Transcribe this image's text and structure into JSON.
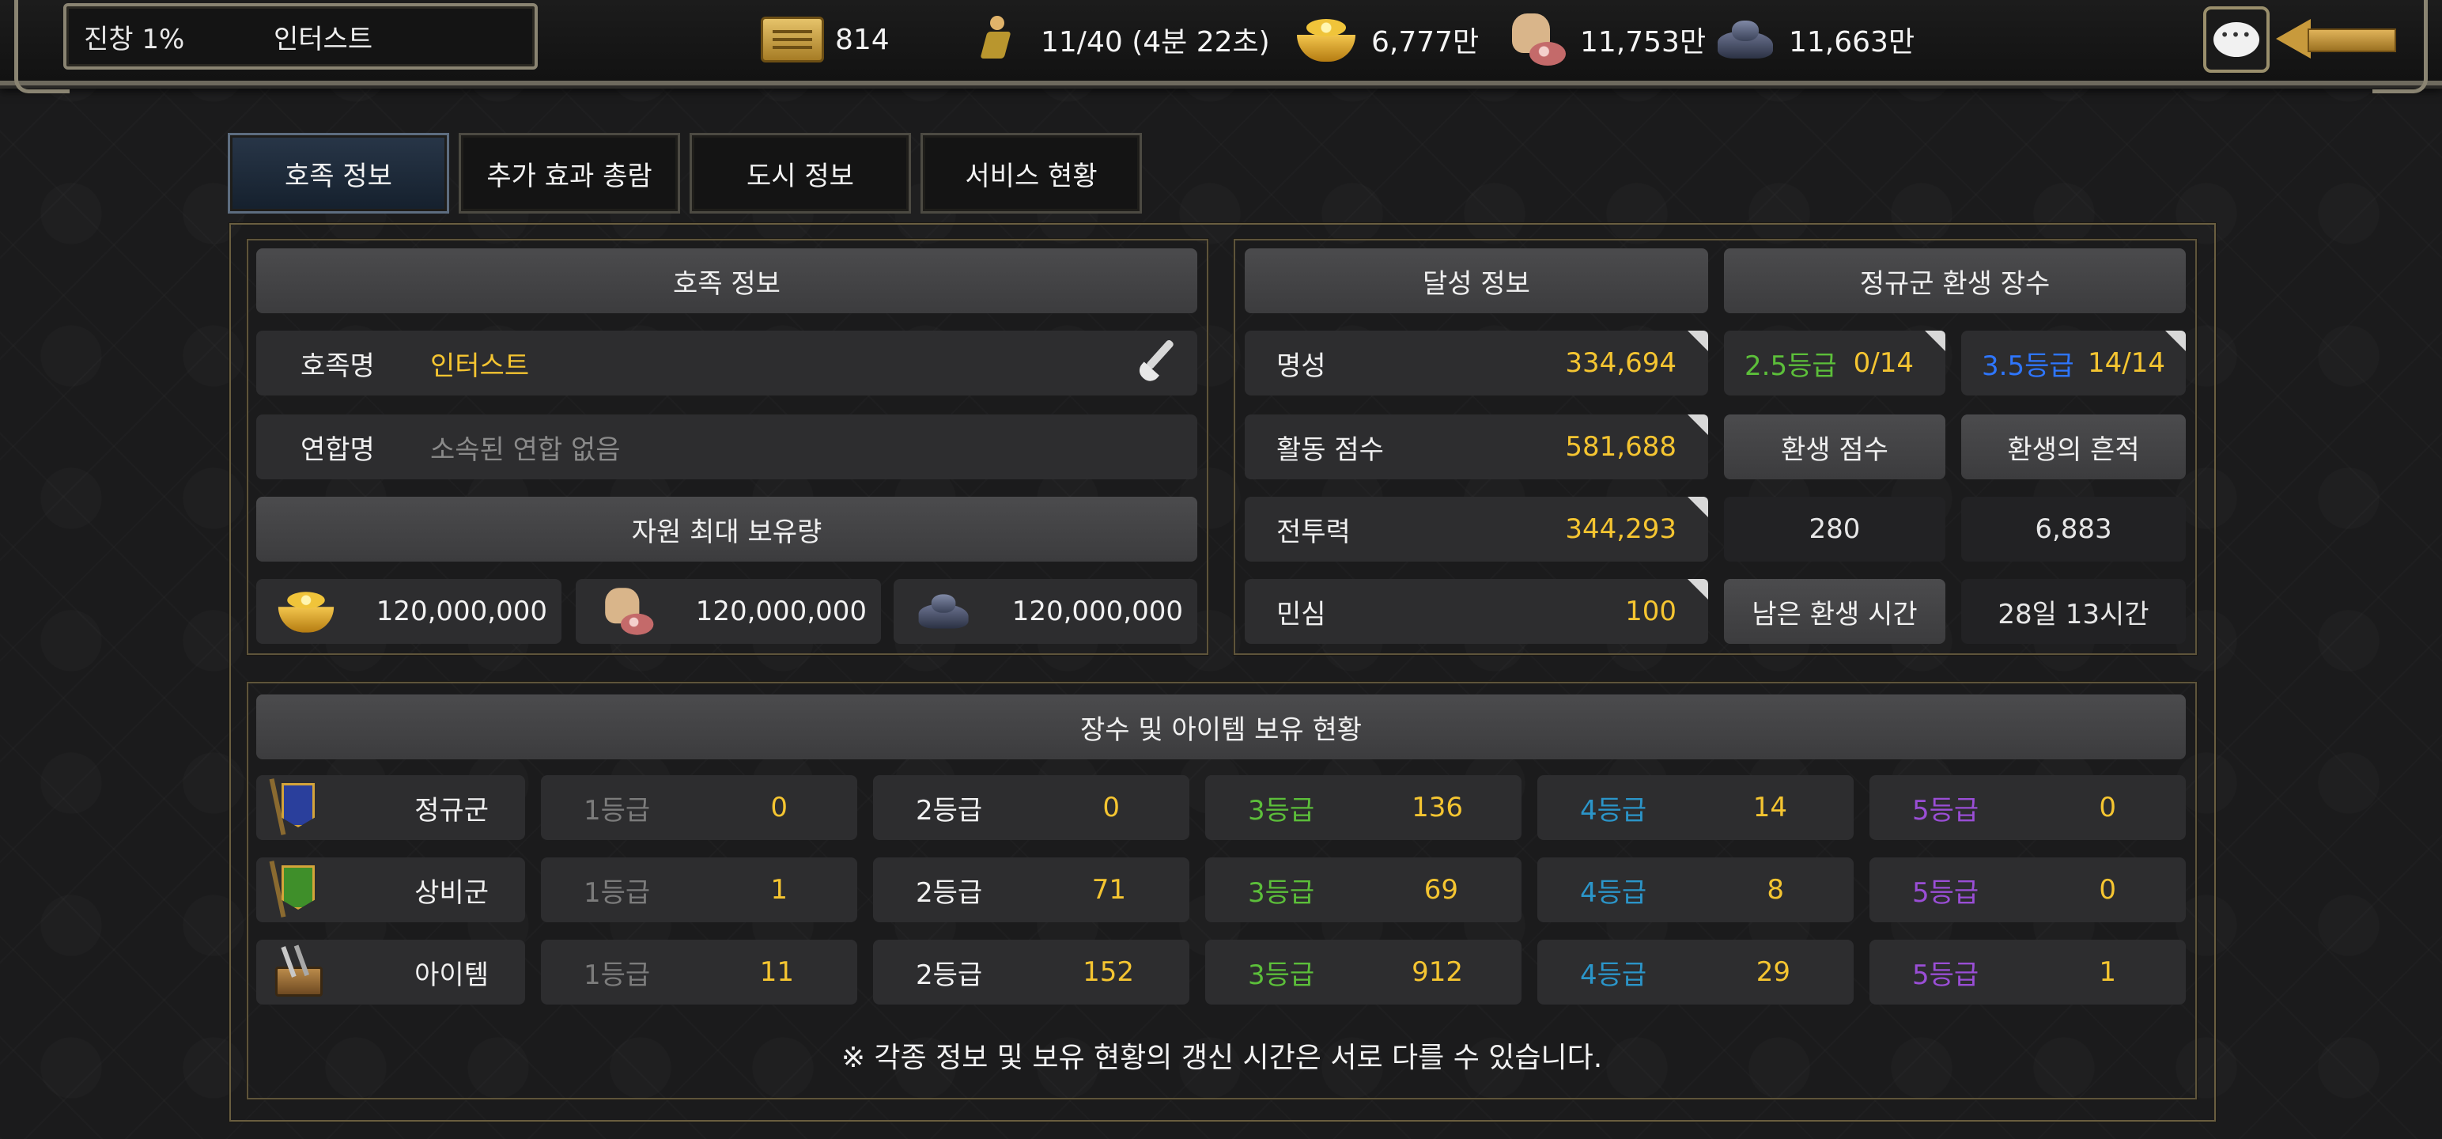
{
  "topbar": {
    "rank": "진창 1%",
    "name": "인터스트",
    "resources": [
      {
        "icon": "scroll-icon",
        "value": "814"
      },
      {
        "icon": "runner-icon",
        "value": "11/40 (4분 22초)"
      },
      {
        "icon": "gold-icon",
        "value": "6,777만"
      },
      {
        "icon": "food-icon",
        "value": "11,753만"
      },
      {
        "icon": "ore-icon",
        "value": "11,663만"
      }
    ]
  },
  "tabs": [
    {
      "label": "호족 정보",
      "active": true
    },
    {
      "label": "추가 효과 총람",
      "active": false
    },
    {
      "label": "도시 정보",
      "active": false
    },
    {
      "label": "서비스 현황",
      "active": false
    }
  ],
  "clan": {
    "header": "호족 정보",
    "name_label": "호족명",
    "name_value": "인터스트",
    "alliance_label": "연합명",
    "alliance_value": "소속된 연합 없음",
    "capacity_header": "자원 최대 보유량",
    "capacity": [
      {
        "icon": "gold-icon",
        "value": "120,000,000"
      },
      {
        "icon": "food-icon",
        "value": "120,000,000"
      },
      {
        "icon": "ore-icon",
        "value": "120,000,000"
      }
    ]
  },
  "achievements": {
    "header": "달성 정보",
    "rows": [
      {
        "label": "명성",
        "value": "334,694"
      },
      {
        "label": "활동 점수",
        "value": "581,688"
      },
      {
        "label": "전투력",
        "value": "344,293"
      },
      {
        "label": "민심",
        "value": "100"
      }
    ]
  },
  "rebirth": {
    "header": "정규군 환생 장수",
    "grade_a_label": "2.5등급",
    "grade_a_value": "0/14",
    "grade_b_label": "3.5등급",
    "grade_b_value": "14/14",
    "score_label": "환생 점수",
    "trace_label": "환생의 흔적",
    "score_value": "280",
    "trace_value": "6,883",
    "remaining_label": "남은 환생 시간",
    "remaining_value": "28일 13시간"
  },
  "holdings": {
    "header": "장수 및 아이템 보유 현황",
    "grade_labels": [
      "1등급",
      "2등급",
      "3등급",
      "4등급",
      "5등급"
    ],
    "rows": [
      {
        "label": "정규군",
        "icon": "blue-banner-icon",
        "values": [
          "0",
          "0",
          "136",
          "14",
          "0"
        ]
      },
      {
        "label": "상비군",
        "icon": "green-banner-icon",
        "values": [
          "1",
          "71",
          "69",
          "8",
          "0"
        ]
      },
      {
        "label": "아이템",
        "icon": "treasure-chest-icon",
        "values": [
          "11",
          "152",
          "912",
          "29",
          "1"
        ]
      }
    ],
    "note": "※ 각종 정보 및 보유 현황의 갱신 시간은 서로 다를 수 있습니다."
  },
  "colors": {
    "accent_gold": "#f5c531",
    "grade1": "#7c7c7c",
    "grade2": "#f2f2f2",
    "grade3": "#5cbf3a",
    "grade4": "#2b95c9",
    "grade5": "#9a4ed6",
    "grade35": "#2e76ff"
  }
}
